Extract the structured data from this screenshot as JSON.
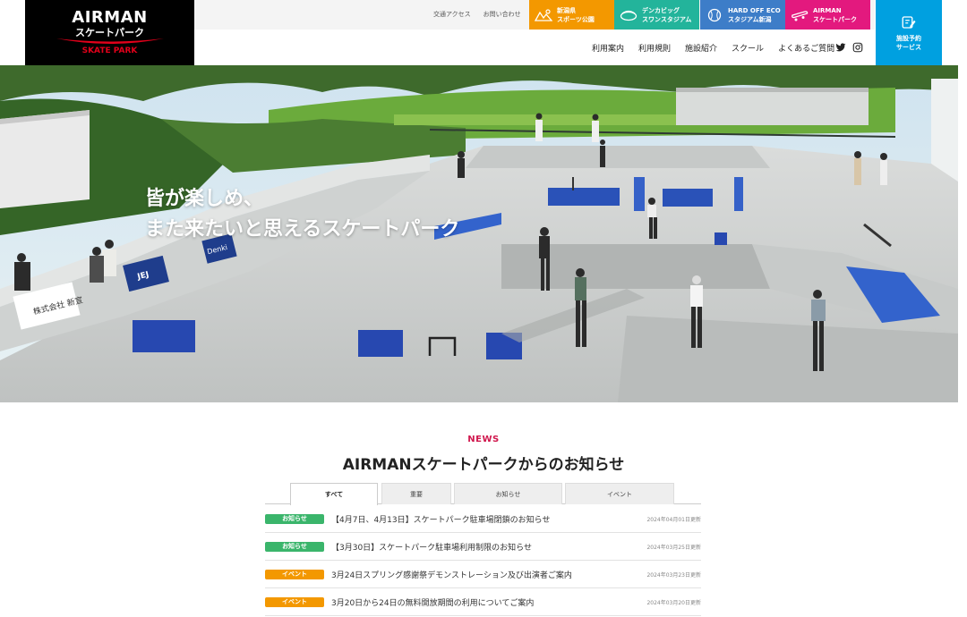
{
  "logo": {
    "line1": "AIRMAN",
    "line2": "スケートパーク",
    "line3": "SKATE PARK"
  },
  "topbar": {
    "links": [
      "交通アクセス",
      "お問い合わせ"
    ],
    "venues": [
      {
        "label": "新潟県\nスポーツ公園",
        "icon": "park-icon",
        "color": "#f39800"
      },
      {
        "label": "デンカビッグ\nスワンスタジアム",
        "icon": "stadium-icon",
        "color": "#23b49b"
      },
      {
        "label": "HARD OFF ECO\nスタジアム新潟",
        "icon": "baseball-icon",
        "color": "#3d7dc8"
      },
      {
        "label": "AIRMAN\nスケートパーク",
        "icon": "skateboard-icon",
        "color": "#e3197e"
      }
    ]
  },
  "nav": {
    "items": [
      "利用案内",
      "利用規則",
      "施設紹介",
      "スクール",
      "よくあるご質問"
    ],
    "social": [
      "twitter-icon",
      "instagram-icon"
    ]
  },
  "booking": {
    "label": "施設予約\nサービス",
    "icon": "edit-icon",
    "color": "#00a0e0"
  },
  "hero": {
    "line1": "皆が楽しめ、",
    "line2": "また来たいと思えるスケートパーク",
    "banners": [
      "株式会社 新宣",
      "JEJ",
      "Denki"
    ]
  },
  "news": {
    "kicker": "NEWS",
    "title": "AIRMANスケートパークからのお知らせ",
    "tabs": [
      "すべて",
      "重要",
      "お知らせ",
      "イベント"
    ],
    "items": [
      {
        "category": "お知らせ",
        "title": "【4月7日、4月13日】スケートパーク駐車場閉鎖のお知らせ",
        "date": "2024年04月01日更新"
      },
      {
        "category": "お知らせ",
        "title": "【3月30日】スケートパーク駐車場利用制限のお知らせ",
        "date": "2024年03月25日更新"
      },
      {
        "category": "イベント",
        "title": "3月24日スプリング感謝祭デモンストレーション及び出演者ご案内",
        "date": "2024年03月23日更新"
      },
      {
        "category": "イベント",
        "title": "3月20日から24日の無料開放期間の利用についてご案内",
        "date": "2024年03月20日更新"
      }
    ]
  }
}
